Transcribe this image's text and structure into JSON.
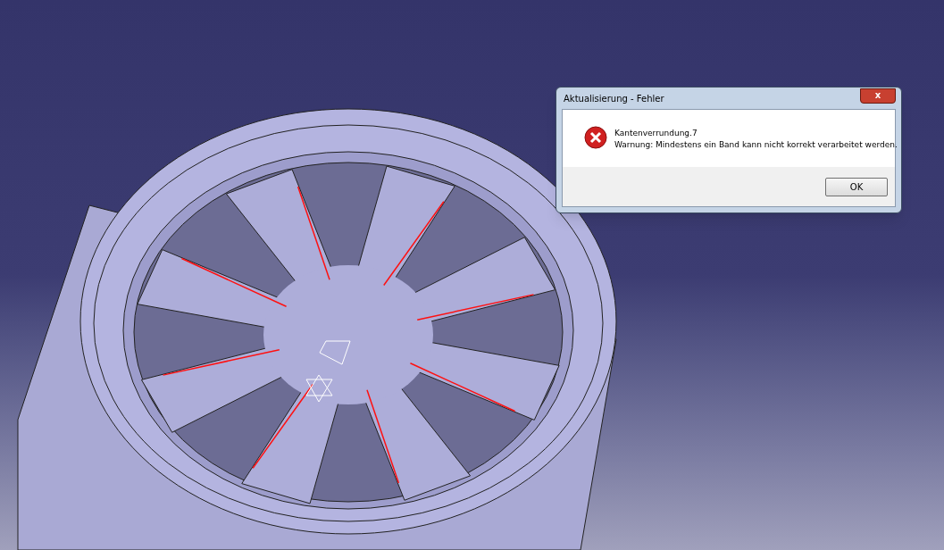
{
  "dialog": {
    "title": "Aktualisierung - Fehler",
    "close_label": "x",
    "heading": "Kantenverrundung.7",
    "message": "Warnung: Mindestens ein Band kann nicht korrekt verarbeitet werden.",
    "buttons": [
      "OK"
    ]
  }
}
